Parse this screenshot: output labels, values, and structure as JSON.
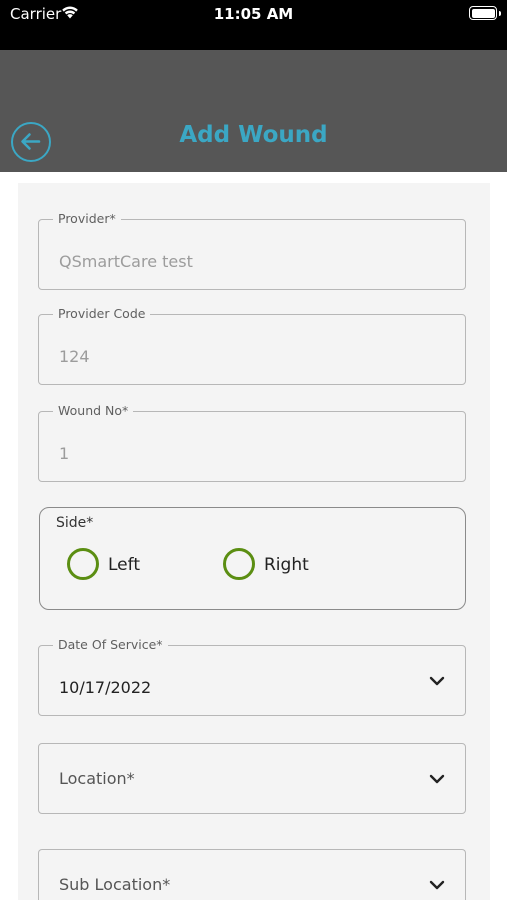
{
  "status_bar": {
    "carrier": "Carrier",
    "time": "11:05 AM",
    "icons": [
      "wifi-icon",
      "battery-icon"
    ]
  },
  "header": {
    "title": "Add Wound",
    "back_icon": "arrow-left-circle-icon",
    "accent_color": "#3ba7c4",
    "background_color": "#565656"
  },
  "form": {
    "provider": {
      "label": "Provider*",
      "value": "QSmartCare test"
    },
    "provider_code": {
      "label": "Provider Code",
      "value": "124"
    },
    "wound_no": {
      "label": "Wound No*",
      "value": "1"
    },
    "side": {
      "label": "Side*",
      "options": [
        "Left",
        "Right"
      ],
      "selected": null,
      "radio_color": "#5b8e12"
    },
    "date_of_service": {
      "label": "Date Of Service*",
      "value": "10/17/2022"
    },
    "location": {
      "placeholder": "Location*"
    },
    "sub_location": {
      "placeholder": "Sub Location*"
    }
  }
}
